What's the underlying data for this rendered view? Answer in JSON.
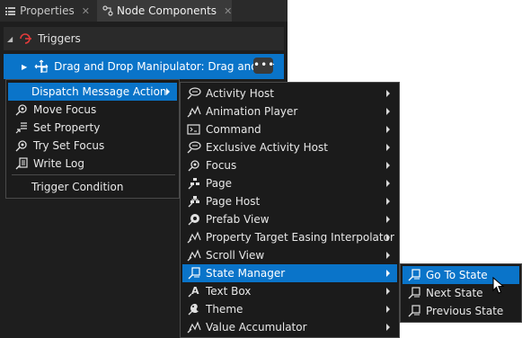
{
  "tabs": [
    {
      "label": "Properties",
      "icon": "list-icon",
      "active": false
    },
    {
      "label": "Node Components",
      "icon": "node-components-icon",
      "active": true
    }
  ],
  "panel": {
    "section_label": "Triggers",
    "section_icon": "trigger-icon",
    "trigger_label": "Drag and Drop Manipulator: Drag and Dr",
    "trigger_icon": "drag-drop-icon",
    "more_label": "•••"
  },
  "action_menu": {
    "items": [
      {
        "label": "Dispatch Message Action",
        "icon": "",
        "has_submenu": true,
        "highlighted": true
      },
      {
        "label": "Move Focus",
        "icon": "focus-icon",
        "has_submenu": false
      },
      {
        "label": "Set Property",
        "icon": "set-property-icon",
        "has_submenu": false
      },
      {
        "label": "Try Set Focus",
        "icon": "focus-icon",
        "has_submenu": false
      },
      {
        "label": "Write Log",
        "icon": "write-log-icon",
        "has_submenu": false
      }
    ],
    "footer_item": {
      "label": "Trigger Condition"
    }
  },
  "node_menu": {
    "items": [
      {
        "label": "Activity Host",
        "icon": "activity-host-icon"
      },
      {
        "label": "Animation Player",
        "icon": "animation-player-icon"
      },
      {
        "label": "Command",
        "icon": "command-icon"
      },
      {
        "label": "Exclusive Activity Host",
        "icon": "activity-host-icon"
      },
      {
        "label": "Focus",
        "icon": "focus-icon"
      },
      {
        "label": "Page",
        "icon": "page-icon"
      },
      {
        "label": "Page Host",
        "icon": "page-host-icon"
      },
      {
        "label": "Prefab View",
        "icon": "prefab-view-icon"
      },
      {
        "label": "Property Target Easing Interpolator",
        "icon": "interpolator-icon"
      },
      {
        "label": "Scroll View",
        "icon": "scroll-view-icon"
      },
      {
        "label": "State Manager",
        "icon": "state-manager-icon",
        "highlighted": true
      },
      {
        "label": "Text Box",
        "icon": "text-box-icon"
      },
      {
        "label": "Theme",
        "icon": "theme-icon"
      },
      {
        "label": "Value Accumulator",
        "icon": "value-accumulator-icon"
      }
    ]
  },
  "state_menu": {
    "items": [
      {
        "label": "Go To State",
        "icon": "state-icon",
        "highlighted": true
      },
      {
        "label": "Next State",
        "icon": "state-icon"
      },
      {
        "label": "Previous State",
        "icon": "state-icon"
      }
    ]
  },
  "colors": {
    "highlight": "#0a74c9",
    "menu_bg": "#1b1b1b",
    "panel_bg": "#1e1e1e",
    "tab_active": "#3a3a3a"
  }
}
